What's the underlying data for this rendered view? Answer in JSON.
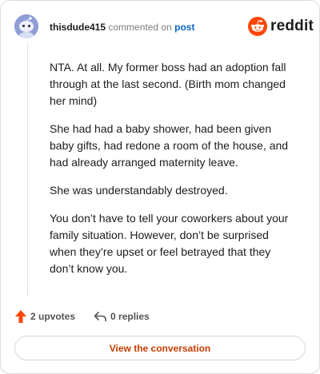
{
  "header": {
    "username": "thisdude415",
    "action": "commented on",
    "post_link": "post"
  },
  "logo": {
    "wordmark": "reddit",
    "brand_color": "#ff4500"
  },
  "comment": {
    "paragraphs": [
      "NTA. At all. My former boss had an adoption fall through at the last second. (Birth mom changed her mind)",
      "She had had a baby shower, had been given baby gifts, had redone a room of the house, and had already arranged maternity leave.",
      "She was understandably destroyed.",
      "You don’t have to tell your coworkers about your family situation. However, don’t be surprised when they’re upset or feel betrayed that they don’t know you."
    ]
  },
  "actions": {
    "upvotes": "2 upvotes",
    "replies": "0 replies",
    "upvote_icon": "upvote-arrow-icon",
    "reply_icon": "reply-arrow-icon"
  },
  "cta": {
    "label": "View the conversation"
  },
  "colors": {
    "avatar_bg": "#8f9fd6",
    "cta_text": "#c63d00",
    "upvote_arrow": "#ff4500",
    "link": "#0a66c2"
  }
}
